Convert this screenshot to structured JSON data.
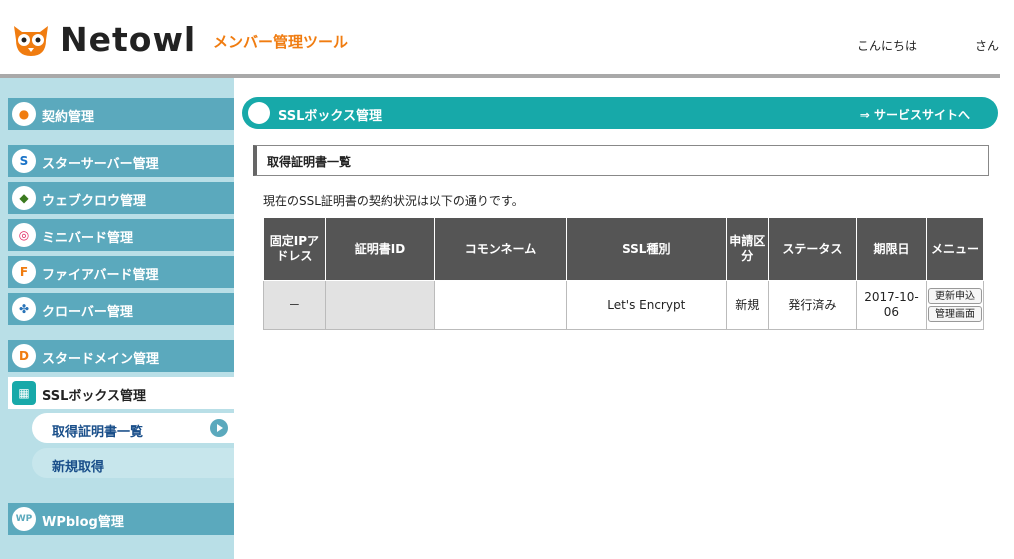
{
  "header": {
    "logo_text": "Netowl",
    "tool_name": "メンバー管理ツール",
    "greeting": "こんにちは",
    "greeting_suffix": "さん"
  },
  "sidebar": {
    "items": [
      {
        "label": "契約管理",
        "icon": "owl-icon"
      },
      {
        "label": "スターサーバー管理",
        "icon": "star-server-icon"
      },
      {
        "label": "ウェブクロウ管理",
        "icon": "crow-icon"
      },
      {
        "label": "ミニバード管理",
        "icon": "minibird-icon"
      },
      {
        "label": "ファイアバード管理",
        "icon": "firebird-icon"
      },
      {
        "label": "クローバー管理",
        "icon": "clover-icon"
      },
      {
        "label": "スタードメイン管理",
        "icon": "star-domain-icon"
      },
      {
        "label": "SSLボックス管理",
        "icon": "sslbox-icon"
      },
      {
        "label": "WPblog管理",
        "icon": "wp-icon"
      }
    ],
    "sub_items": [
      {
        "label": "取得証明書一覧"
      },
      {
        "label": "新規取得"
      }
    ]
  },
  "main": {
    "section_title": "SSLボックス管理",
    "service_link": "⇒ サービスサイトへ",
    "subheading": "取得証明書一覧",
    "description": "現在のSSL証明書の契約状況は以下の通りです。",
    "table": {
      "headers": [
        "固定IPアドレス",
        "証明書ID",
        "コモンネーム",
        "SSL種別",
        "申請区分",
        "ステータス",
        "期限日",
        "メニュー"
      ],
      "rows": [
        {
          "fixed_ip": "－",
          "cert_id": "",
          "common_name": "",
          "ssl_type": "Let's Encrypt",
          "category": "新規",
          "status": "発行済み",
          "expiry": "2017-10-06",
          "menu": [
            "更新申込",
            "管理画面"
          ]
        }
      ]
    }
  },
  "colors": {
    "accent": "#17a9a9",
    "sidebar_bg": "#b9dfe7",
    "sidebar_item": "#5ba9bd",
    "brand_orange": "#f07c10"
  }
}
